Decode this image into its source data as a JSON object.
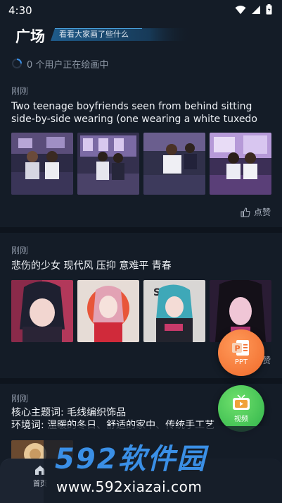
{
  "status_bar": {
    "time": "4:30"
  },
  "header": {
    "title": "广场",
    "subtitle": "看看大家画了些什么"
  },
  "online": {
    "text": "0 个用户正在绘画中"
  },
  "posts": [
    {
      "time": "刚刚",
      "text": "Two teenage boyfriends seen from behind sitting side-by-side wearing (one wearing a white tuxedo top …",
      "thumb_count": 4,
      "like_label": "点赞"
    },
    {
      "time": "刚刚",
      "text": "悲伤的少女 现代风 压抑 意难平 青春",
      "thumb_count": 4,
      "like_label": "赞"
    },
    {
      "time": "刚刚",
      "text_lines": [
        "核心主题词: 毛线编织饰品",
        "环境词: 温暖的冬日、舒适的家中、传统手工艺"
      ]
    }
  ],
  "fab": {
    "ppt_label": "PPT",
    "ppt_icon_letter": "P",
    "video_label": "视频"
  },
  "bottom_nav": {
    "home_label": "首页"
  },
  "watermark": {
    "brand": "592软件园",
    "url": "www.592xiazai.com"
  },
  "colors": {
    "background": "#141c27",
    "accent": "#3a8fe6",
    "ppt": "#f06a2a",
    "video": "#2fb34a"
  },
  "icons": [
    "wifi-icon",
    "signal-icon",
    "battery-icon",
    "spinner-icon",
    "thumbs-up-icon",
    "ppt-icon",
    "tv-icon",
    "home-icon"
  ]
}
